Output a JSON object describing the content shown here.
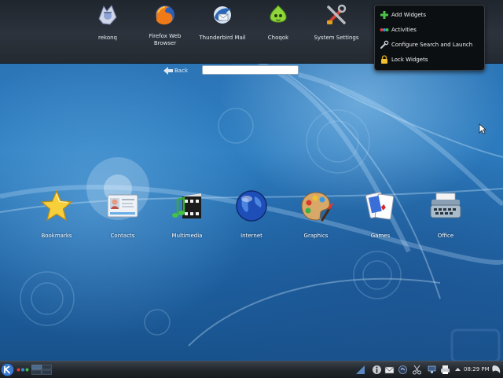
{
  "favorites": [
    {
      "label": "rekonq",
      "icon": "rekonq-icon"
    },
    {
      "label": "Firefox Web Browser",
      "icon": "firefox-icon"
    },
    {
      "label": "Thunderbird Mail",
      "icon": "thunderbird-icon"
    },
    {
      "label": "Choqok",
      "icon": "choqok-icon"
    },
    {
      "label": "System Settings",
      "icon": "system-settings-icon"
    }
  ],
  "context_menu": {
    "items": [
      {
        "label": "Add Widgets",
        "icon": "add-icon"
      },
      {
        "label": "Activities",
        "icon": "activities-icon"
      },
      {
        "label": "Configure Search and Launch",
        "icon": "wrench-icon"
      },
      {
        "label": "Lock Widgets",
        "icon": "lock-icon"
      }
    ]
  },
  "nav": {
    "back_label": "Back"
  },
  "search": {
    "value": "",
    "placeholder": ""
  },
  "categories": [
    {
      "label": "Bookmarks",
      "icon": "bookmarks-star-icon"
    },
    {
      "label": "Contacts",
      "icon": "contacts-icon"
    },
    {
      "label": "Multimedia",
      "icon": "multimedia-icon"
    },
    {
      "label": "Internet",
      "icon": "internet-globe-icon"
    },
    {
      "label": "Graphics",
      "icon": "graphics-palette-icon"
    },
    {
      "label": "Games",
      "icon": "games-cards-icon"
    },
    {
      "label": "Office",
      "icon": "office-typewriter-icon"
    }
  ],
  "panel": {
    "clock": "08:29 PM",
    "tray_icons": [
      "info-icon",
      "mail-icon",
      "klipper-icon",
      "scissors-icon",
      "network-icon",
      "printer-icon",
      "expand-arrow-icon"
    ]
  },
  "colors": {
    "panel": "#22272d",
    "desktop": "#2a6fb0",
    "menu": "#0c0f12"
  }
}
